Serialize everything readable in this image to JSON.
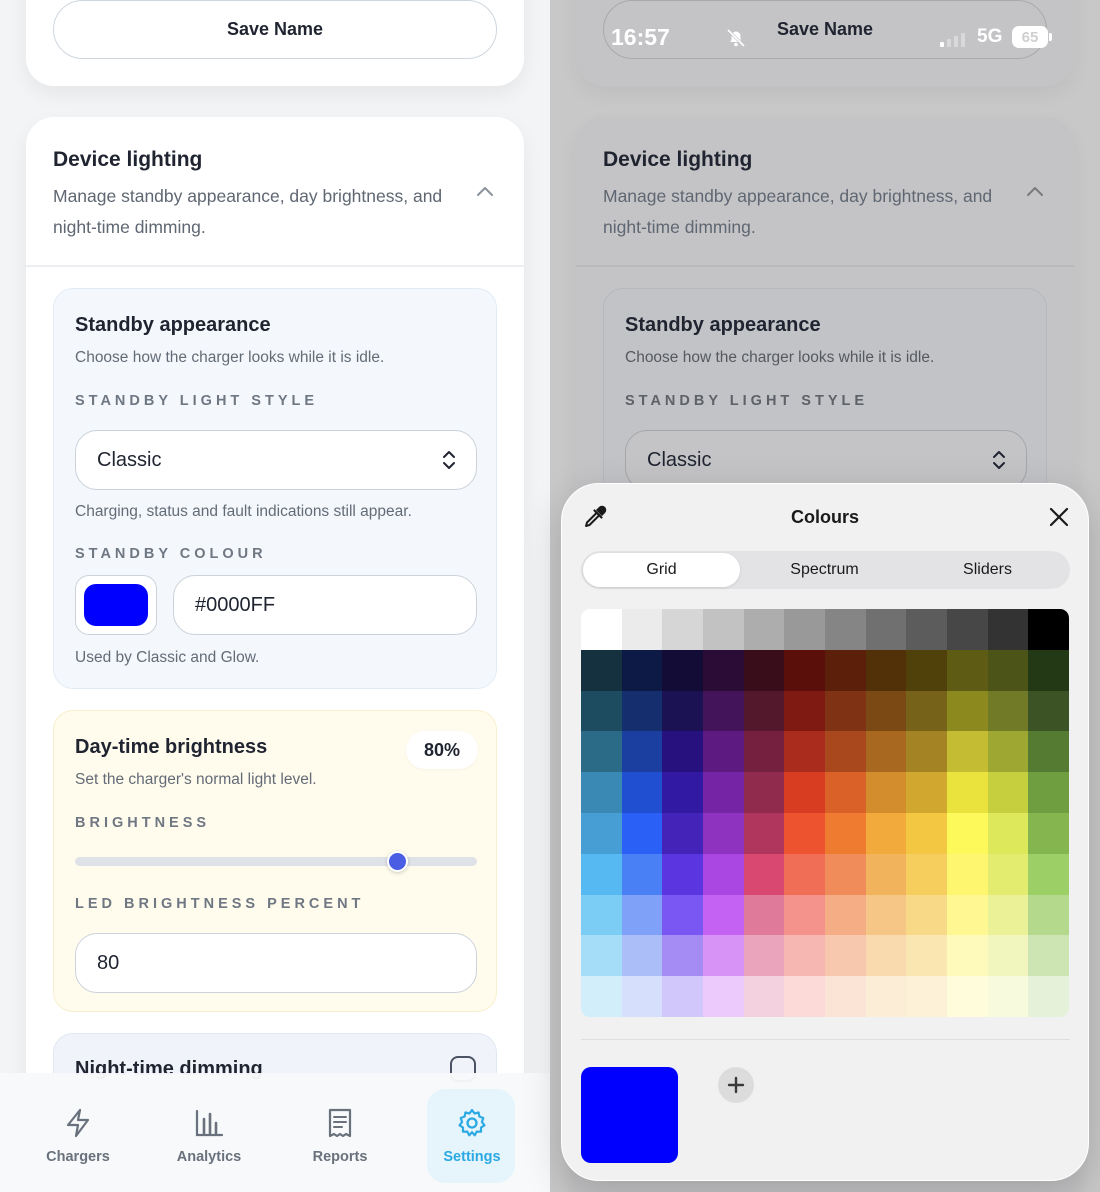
{
  "profile": {
    "save_label": "Save Name"
  },
  "lighting": {
    "title": "Device lighting",
    "description": "Manage standby appearance, day brightness, and night-time dimming."
  },
  "standby": {
    "title": "Standby appearance",
    "description": "Choose how the charger looks while it is idle.",
    "style_label": "STANDBY LIGHT STYLE",
    "style_value": "Classic",
    "style_hint": "Charging, status and fault indications still appear.",
    "colour_label": "STANDBY COLOUR",
    "colour_value": "#0000FF",
    "colour_swatch": "#0000FF",
    "colour_hint": "Used by Classic and Glow."
  },
  "brightness": {
    "title": "Day-time brightness",
    "badge": "80%",
    "description": "Set the charger's normal light level.",
    "slider_label": "BRIGHTNESS",
    "slider_value": 0.8,
    "percent_label": "LED BRIGHTNESS PERCENT",
    "percent_value": "80",
    "accent": "#4A5DE3"
  },
  "night": {
    "title": "Night-time dimming"
  },
  "tabbar": {
    "items": [
      {
        "label": "Chargers",
        "icon": "lightning-icon"
      },
      {
        "label": "Analytics",
        "icon": "bar-chart-icon"
      },
      {
        "label": "Reports",
        "icon": "receipt-icon"
      },
      {
        "label": "Settings",
        "icon": "gear-icon"
      }
    ],
    "active": "Settings",
    "active_color": "#2AA9E3"
  },
  "statusbar": {
    "time": "16:57",
    "network": "5G",
    "battery": "65"
  },
  "picker": {
    "title": "Colours",
    "tabs": [
      "Grid",
      "Spectrum",
      "Sliders"
    ],
    "active_tab": "Grid",
    "current_colour": "#0000FF",
    "grid_colours": [
      [
        "#FFFFFF",
        "#EBEBEB",
        "#D6D6D6",
        "#C2C2C2",
        "#ADADAD",
        "#999999",
        "#858585",
        "#707070",
        "#5C5C5C",
        "#474747",
        "#333333",
        "#000000"
      ],
      [
        "#15303F",
        "#0D1A45",
        "#120C37",
        "#2A0C37",
        "#3A0D1A",
        "#5B0F0B",
        "#5C1F0A",
        "#523109",
        "#50400A",
        "#5E5C14",
        "#4C5418",
        "#233916"
      ],
      [
        "#1D4C60",
        "#142E6E",
        "#1B1253",
        "#43145A",
        "#54182C",
        "#7F1A12",
        "#7F3214",
        "#7B4A14",
        "#77621A",
        "#8C891F",
        "#717A26",
        "#3C5425"
      ],
      [
        "#2C6B88",
        "#1B3FA0",
        "#26117E",
        "#5D1B82",
        "#74203E",
        "#A92C1C",
        "#A9471D",
        "#A8681F",
        "#A48324",
        "#C4BD33",
        "#9DA731",
        "#557A31"
      ],
      [
        "#3A89B5",
        "#214FD1",
        "#3219A4",
        "#7624A6",
        "#912B4D",
        "#D83D22",
        "#DA6229",
        "#D38D2D",
        "#D1A730",
        "#EAE33E",
        "#C6D03E",
        "#6E9E3F"
      ],
      [
        "#469ED4",
        "#2B60F6",
        "#4423B9",
        "#8E32C0",
        "#B1365E",
        "#EE532F",
        "#EF7B31",
        "#F2AA3D",
        "#F4C742",
        "#FEF95A",
        "#DDE85A",
        "#84B54E"
      ],
      [
        "#56B9F1",
        "#4A80F6",
        "#5B35E0",
        "#AA46E2",
        "#D94871",
        "#F06E55",
        "#F08C59",
        "#F2B35D",
        "#F5CE5E",
        "#FEF66F",
        "#E4EC6F",
        "#9DCF67"
      ],
      [
        "#7BCDF5",
        "#7FA1F7",
        "#7A57F2",
        "#C462F4",
        "#E07A9B",
        "#F4938B",
        "#F5AD85",
        "#F6C687",
        "#F7D988",
        "#FEF792",
        "#EBF197",
        "#B4D98C"
      ],
      [
        "#A5DDF8",
        "#ABBEF8",
        "#A58CF5",
        "#D893F6",
        "#EAA5BD",
        "#F6B6B1",
        "#F8C8AE",
        "#F9DAAF",
        "#FAE6B0",
        "#FEFABB",
        "#F1F6BE",
        "#CDE5B3"
      ],
      [
        "#D2EEFB",
        "#D6DFFB",
        "#D2C7FA",
        "#ECCAFB",
        "#F4D1DE",
        "#FBDAD8",
        "#FBE3D6",
        "#FCEDD7",
        "#FDF2D7",
        "#FFFCDC",
        "#F7FADD",
        "#E5F1D9"
      ]
    ]
  }
}
